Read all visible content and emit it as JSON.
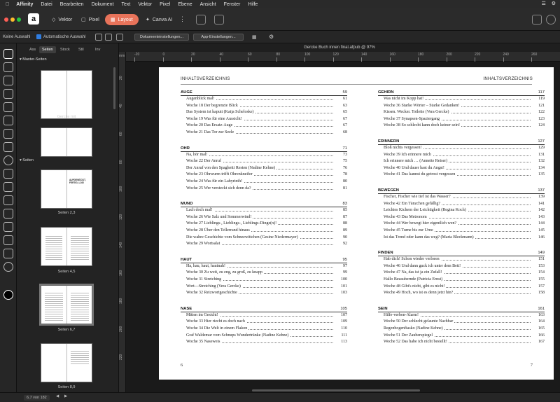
{
  "menubar": {
    "app": "Affinity",
    "items": [
      "Datei",
      "Bearbeiten",
      "Dokument",
      "Text",
      "Vektor",
      "Pixel",
      "Ebene",
      "Ansicht",
      "Fenster",
      "Hilfe"
    ]
  },
  "personas": {
    "vector": "Vektor",
    "pixel": "Pixel",
    "layout": "Layout",
    "canva": "Canva AI"
  },
  "context": {
    "selection": "Keine Auswahl",
    "auto_select": "Automatische Auswahl",
    "doc_settings": "Dokumenteinstellungen...",
    "app_settings": "App-Einstellungen..."
  },
  "document_title": "Gercke Buch innen final.afpub @ 97%",
  "panel": {
    "tabs": [
      "Ass",
      "Seiten",
      "Stock",
      "Stil",
      "Inv"
    ],
    "master_title": "Master-Seiten",
    "master_label": "Gercke mit",
    "pages_title": "Seiten",
    "spreads": [
      "Seiten 2,3",
      "Seiten 4,5",
      "Seiten 6,7",
      "Seiten 8,9"
    ],
    "thumb_title": "AUFGEWÜCKT, FERTIG, LOS!"
  },
  "ruler": {
    "units": "mm",
    "h_ticks": [
      "-20",
      "0",
      "20",
      "40",
      "60",
      "80",
      "100",
      "120",
      "140",
      "160",
      "180",
      "200",
      "220",
      "240",
      "260"
    ],
    "v_ticks": [
      "20",
      "40",
      "60",
      "80",
      "100",
      "120",
      "140",
      "160",
      "180",
      "200",
      "220"
    ]
  },
  "status": {
    "page_indicator": "6,7 von 182"
  },
  "left_page": {
    "header": "INHALTSVERZEICHNIS",
    "number": "6",
    "sections": [
      {
        "title": "AUGE",
        "page": "59",
        "entries": [
          [
            "Augenblick mal!",
            "61"
          ],
          [
            "Woche 18  Der begrenzte Blick",
            "63"
          ],
          [
            "Das System ist kaputt  (Katja Scheloske)",
            "65"
          ],
          [
            "Woche 19  Was für eine Aussicht!",
            "67"
          ],
          [
            "Woche 20 Das Ersatz-Auge",
            "67"
          ],
          [
            "Woche 21  Das Tor zur Seele",
            "68"
          ]
        ]
      },
      {
        "title": "OHR",
        "page": "71",
        "entries": [
          [
            "Na, hör mal!",
            "73"
          ],
          [
            "Woche 22 Der Anruf",
            "75"
          ],
          [
            "Der Anruf von den Spaghetti Resten  (Nadine Kehne)",
            "76"
          ],
          [
            "Woche 23 Ohrwurm trifft Ohrenkneifer",
            "78"
          ],
          [
            "Woche 24 Was für ein Labyrinth!",
            "80"
          ],
          [
            "Woche 25 Wer versteckt sich denn da?",
            "81"
          ]
        ]
      },
      {
        "title": "MUND",
        "page": "83",
        "entries": [
          [
            "Lach doch mal!",
            "85"
          ],
          [
            "Woche 26 Wie Salz und Sommerwind!",
            "87"
          ],
          [
            "Woche 27 Lieblings-, Lieblings-, Lieblings-Dinge(n)!",
            "88"
          ],
          [
            "Woche 28 Über den Tellerrand hinaus",
            "89"
          ],
          [
            "Die wahre Geschichte vom Schneewittchen  (Gesine Niedermayer)",
            "90"
          ],
          [
            "Woche 29 Wortsalat",
            "92"
          ]
        ]
      },
      {
        "title": "HAUT",
        "page": "95",
        "entries": [
          [
            "Ha, hau, haut, hautnah!",
            "97"
          ],
          [
            "Woche 30 Zu weit, zu eng, zu groß, zu knapp",
            "99"
          ],
          [
            "Woche 31 Stretching",
            "100"
          ],
          [
            "Wort—Stretching  (Vera Gercke)",
            "101"
          ],
          [
            "Woche 32 Reizwortgeschichte",
            "103"
          ]
        ]
      },
      {
        "title": "NASE",
        "page": "105",
        "entries": [
          [
            "Mitten im Gesicht!",
            "107"
          ],
          [
            "Woche 33 Hier riecht es doch nach",
            "109"
          ],
          [
            "Woche 34 Die Welt in einem Flakon",
            "110"
          ],
          [
            "Graf Waldemar vom Schnups Wundertränke  (Nadine Kehne)",
            "111"
          ],
          [
            "Woche 35 Naseweis",
            "113"
          ]
        ]
      }
    ]
  },
  "right_page": {
    "header": "INHALTSVERZEICHNIS",
    "number": "7",
    "sections": [
      {
        "title": "GEHIRN",
        "page": "117",
        "entries": [
          [
            "Was nicht im Kopp hat!",
            "119"
          ],
          [
            "Woche 36 Starke Wörter – Starke Gedanken!",
            "121"
          ],
          [
            "Kissen. Wecker. Toilette  (Vera Gercke)",
            "122"
          ],
          [
            "Woche 37 Synapsen-Spaziergang",
            "123"
          ],
          [
            "Woche 38 So schlecht kann doch keiner sein!",
            "124"
          ]
        ]
      },
      {
        "title": "ERINNERN",
        "page": "127",
        "entries": [
          [
            "Bloß nichts vergessen!",
            "129"
          ],
          [
            "Woche 39 Ich erinnere mich",
            "131"
          ],
          [
            "Ich erinnere mich …   (Annette Reiser)",
            "132"
          ],
          [
            "Woche 40 Und dauer hast du Angst!",
            "134"
          ],
          [
            "Woche 41 Das kannst du getrost vergessen",
            "135"
          ]
        ]
      },
      {
        "title": "BEWEGEN",
        "page": "137",
        "entries": [
          [
            "Fischer, Fischer wie tief ist das Wasser?",
            "139"
          ],
          [
            "Woche 42 Ein Tänzchen gefällig?",
            "141"
          ],
          [
            "Leichtes Kichern der Leichtigkeit  (Regina Koch)",
            "142"
          ],
          [
            "Woche 43 Das Metronom",
            "143"
          ],
          [
            "Woche 44 Wer bewegt hier eigentlich wen?",
            "144"
          ],
          [
            "Woche 45 Turne bis zur Urne",
            "145"
          ],
          [
            "Ist das Trend oder kann das weg?  (Maria Bleckmann)",
            "146"
          ]
        ]
      },
      {
        "title": "FINDEN",
        "page": "149",
        "entries": [
          [
            "Hab dich! Schon wieder verloren",
            "151"
          ],
          [
            "Woche 46 Und dann guck ich unter dem Bett!",
            "153"
          ],
          [
            "Woche 47 Na, das ist ja ein Zufall!",
            "154"
          ],
          [
            "Hallo Bezaubernde  (Patricia Ernst)",
            "155"
          ],
          [
            "Woche 48 Gibt's nicht, gibt es nicht!",
            "157"
          ],
          [
            "Woche 49 Hoch, wo ist es denn jetzt hin?",
            "158"
          ]
        ]
      },
      {
        "title": "SEIN",
        "page": "161",
        "entries": [
          [
            "Hilfe-verben-Alarm!",
            "163"
          ],
          [
            "Woche 50 Der schlecht gelaunte Nachbar",
            "164"
          ],
          [
            "Regenbogenfiasko  (Nadine Kehne)",
            "165"
          ],
          [
            "Woche 51 Der Zauberspiegel",
            "166"
          ],
          [
            "Woche 52 Das habe ich nicht bestellt!",
            "167"
          ]
        ]
      }
    ]
  },
  "colors": {
    "accent": "#e8735a",
    "canvas": "#1a1a1a",
    "page": "#ffffff"
  }
}
